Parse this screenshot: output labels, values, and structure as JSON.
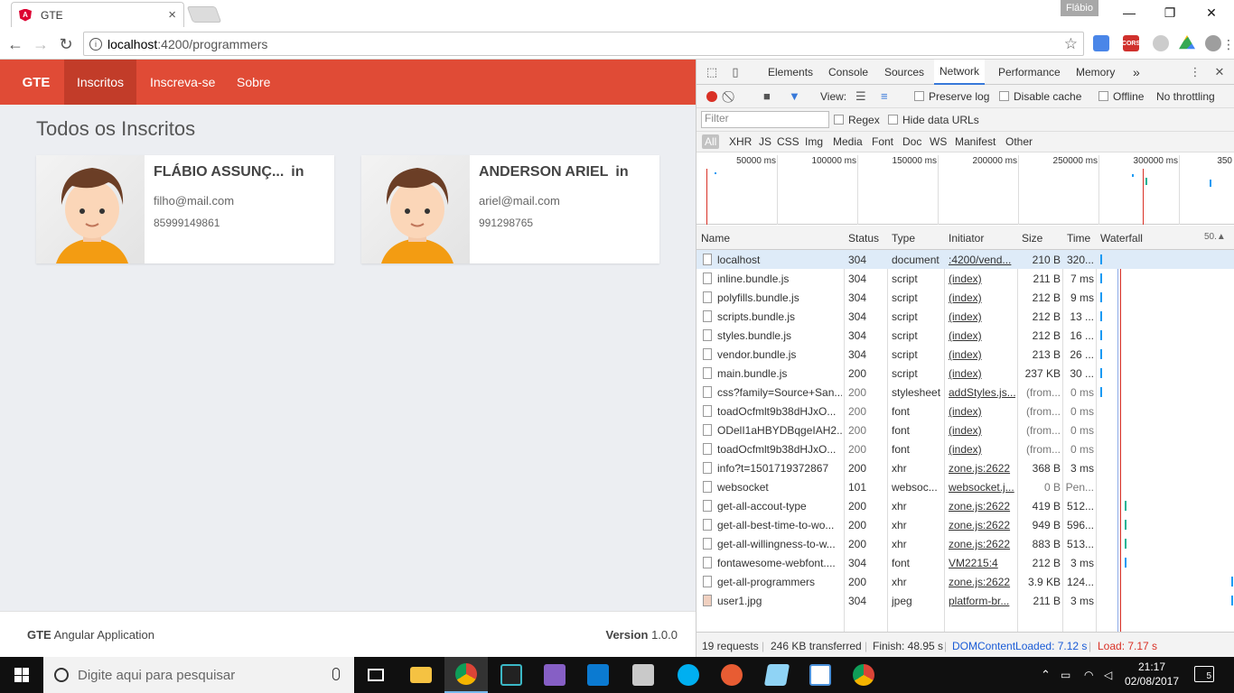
{
  "browser": {
    "tab_title": "GTE",
    "tab_close": "×",
    "user_name": "Flábio",
    "url_host": "localhost",
    "url_path": ":4200/programmers",
    "back": "←",
    "forward": "→",
    "reload": "↻",
    "star": "☆",
    "minimize": "—",
    "restore": "❐",
    "close": "✕",
    "cors_label": "CORS",
    "menu": "⋮"
  },
  "app": {
    "brand": "GTE",
    "nav": [
      {
        "label": "Inscritos",
        "active": true
      },
      {
        "label": "Inscreva-se",
        "active": false
      },
      {
        "label": "Sobre",
        "active": false
      }
    ],
    "page_title": "Todos os Inscritos",
    "cards": [
      {
        "name": "FLÁBIO ASSUNÇ...",
        "linkedin": "in",
        "email": "filho@mail.com",
        "phone": "85999149861"
      },
      {
        "name": "ANDERSON ARIEL",
        "linkedin": "in",
        "email": "ariel@mail.com",
        "phone": "991298765"
      }
    ],
    "footer": {
      "brand": "GTE",
      "brand_suffix": " Angular Application",
      "version_label": "Version",
      "version": " 1.0.0"
    }
  },
  "devtools": {
    "tabs": [
      "Elements",
      "Console",
      "Sources",
      "Network",
      "Performance",
      "Memory"
    ],
    "more_tabs": "»",
    "kebab": "⋮",
    "close": "✕",
    "view_label": "View:",
    "preserve_log": "Preserve log",
    "disable_cache": "Disable cache",
    "offline": "Offline",
    "throttling": "No throttling",
    "filter_placeholder": "Filter",
    "regex": "Regex",
    "hide_data_urls": "Hide data URLs",
    "type_filters": [
      "All",
      "XHR",
      "JS",
      "CSS",
      "Img",
      "Media",
      "Font",
      "Doc",
      "WS",
      "Manifest",
      "Other"
    ],
    "overview_ticks": [
      "50000 ms",
      "100000 ms",
      "150000 ms",
      "200000 ms",
      "250000 ms",
      "300000 ms",
      "350"
    ],
    "columns": [
      "Name",
      "Status",
      "Type",
      "Initiator",
      "Size",
      "Time",
      "Waterfall"
    ],
    "waterfall_sort": "50.▲",
    "requests": [
      {
        "name": "localhost",
        "status": "304",
        "type": "document",
        "initiator": ":4200/vend...",
        "size": "210 B",
        "time": "320...",
        "wf": 1
      },
      {
        "name": "inline.bundle.js",
        "status": "304",
        "type": "script",
        "initiator": "(index)",
        "size": "211 B",
        "time": "7 ms",
        "wf": 1
      },
      {
        "name": "polyfills.bundle.js",
        "status": "304",
        "type": "script",
        "initiator": "(index)",
        "size": "212 B",
        "time": "9 ms",
        "wf": 1
      },
      {
        "name": "scripts.bundle.js",
        "status": "304",
        "type": "script",
        "initiator": "(index)",
        "size": "212 B",
        "time": "13 ...",
        "wf": 1
      },
      {
        "name": "styles.bundle.js",
        "status": "304",
        "type": "script",
        "initiator": "(index)",
        "size": "212 B",
        "time": "16 ...",
        "wf": 1
      },
      {
        "name": "vendor.bundle.js",
        "status": "304",
        "type": "script",
        "initiator": "(index)",
        "size": "213 B",
        "time": "26 ...",
        "wf": 1
      },
      {
        "name": "main.bundle.js",
        "status": "200",
        "type": "script",
        "initiator": "(index)",
        "size": "237 KB",
        "time": "30 ...",
        "wf": 1
      },
      {
        "name": "css?family=Source+San...",
        "status": "200",
        "type": "stylesheet",
        "initiator": "addStyles.js...",
        "size": "(from...",
        "time": "0 ms",
        "wf": 1
      },
      {
        "name": "toadOcfmlt9b38dHJxO...",
        "status": "200",
        "type": "font",
        "initiator": "(index)",
        "size": "(from...",
        "time": "0 ms",
        "wf": 0
      },
      {
        "name": "ODelI1aHBYDBqgeIAH2...",
        "status": "200",
        "type": "font",
        "initiator": "(index)",
        "size": "(from...",
        "time": "0 ms",
        "wf": 0
      },
      {
        "name": "toadOcfmlt9b38dHJxO...",
        "status": "200",
        "type": "font",
        "initiator": "(index)",
        "size": "(from...",
        "time": "0 ms",
        "wf": 0
      },
      {
        "name": "info?t=1501719372867",
        "status": "200",
        "type": "xhr",
        "initiator": "zone.js:2622",
        "size": "368 B",
        "time": "3 ms",
        "wf": 0
      },
      {
        "name": "websocket",
        "status": "101",
        "type": "websoc...",
        "initiator": "websocket.j...",
        "size": "0 B",
        "time": "Pen...",
        "wf": 0
      },
      {
        "name": "get-all-accout-type",
        "status": "200",
        "type": "xhr",
        "initiator": "zone.js:2622",
        "size": "419 B",
        "time": "512...",
        "wf": 2
      },
      {
        "name": "get-all-best-time-to-wo...",
        "status": "200",
        "type": "xhr",
        "initiator": "zone.js:2622",
        "size": "949 B",
        "time": "596...",
        "wf": 2
      },
      {
        "name": "get-all-willingness-to-w...",
        "status": "200",
        "type": "xhr",
        "initiator": "zone.js:2622",
        "size": "883 B",
        "time": "513...",
        "wf": 2
      },
      {
        "name": "fontawesome-webfont....",
        "status": "304",
        "type": "font",
        "initiator": "VM2215:4",
        "size": "212 B",
        "time": "3 ms",
        "wf": 3
      },
      {
        "name": "get-all-programmers",
        "status": "200",
        "type": "xhr",
        "initiator": "zone.js:2622",
        "size": "3.9 KB",
        "time": "124...",
        "wf": 4
      },
      {
        "name": "user1.jpg",
        "status": "304",
        "type": "jpeg",
        "initiator": "platform-br...",
        "size": "211 B",
        "time": "3 ms",
        "wf": 4
      }
    ],
    "summary": {
      "requests": "19 requests",
      "transferred": "246 KB transferred",
      "finish": "Finish: 48.95 s",
      "dcl": "DOMContentLoaded: 7.12 s",
      "load": "Load: 7.17 s"
    },
    "colors": {
      "dcl": "#1a5bd6",
      "load": "#d93025"
    }
  },
  "taskbar": {
    "search_placeholder": "Digite aqui para pesquisar",
    "time": "21:17",
    "date": "02/08/2017",
    "notifications": "5"
  }
}
